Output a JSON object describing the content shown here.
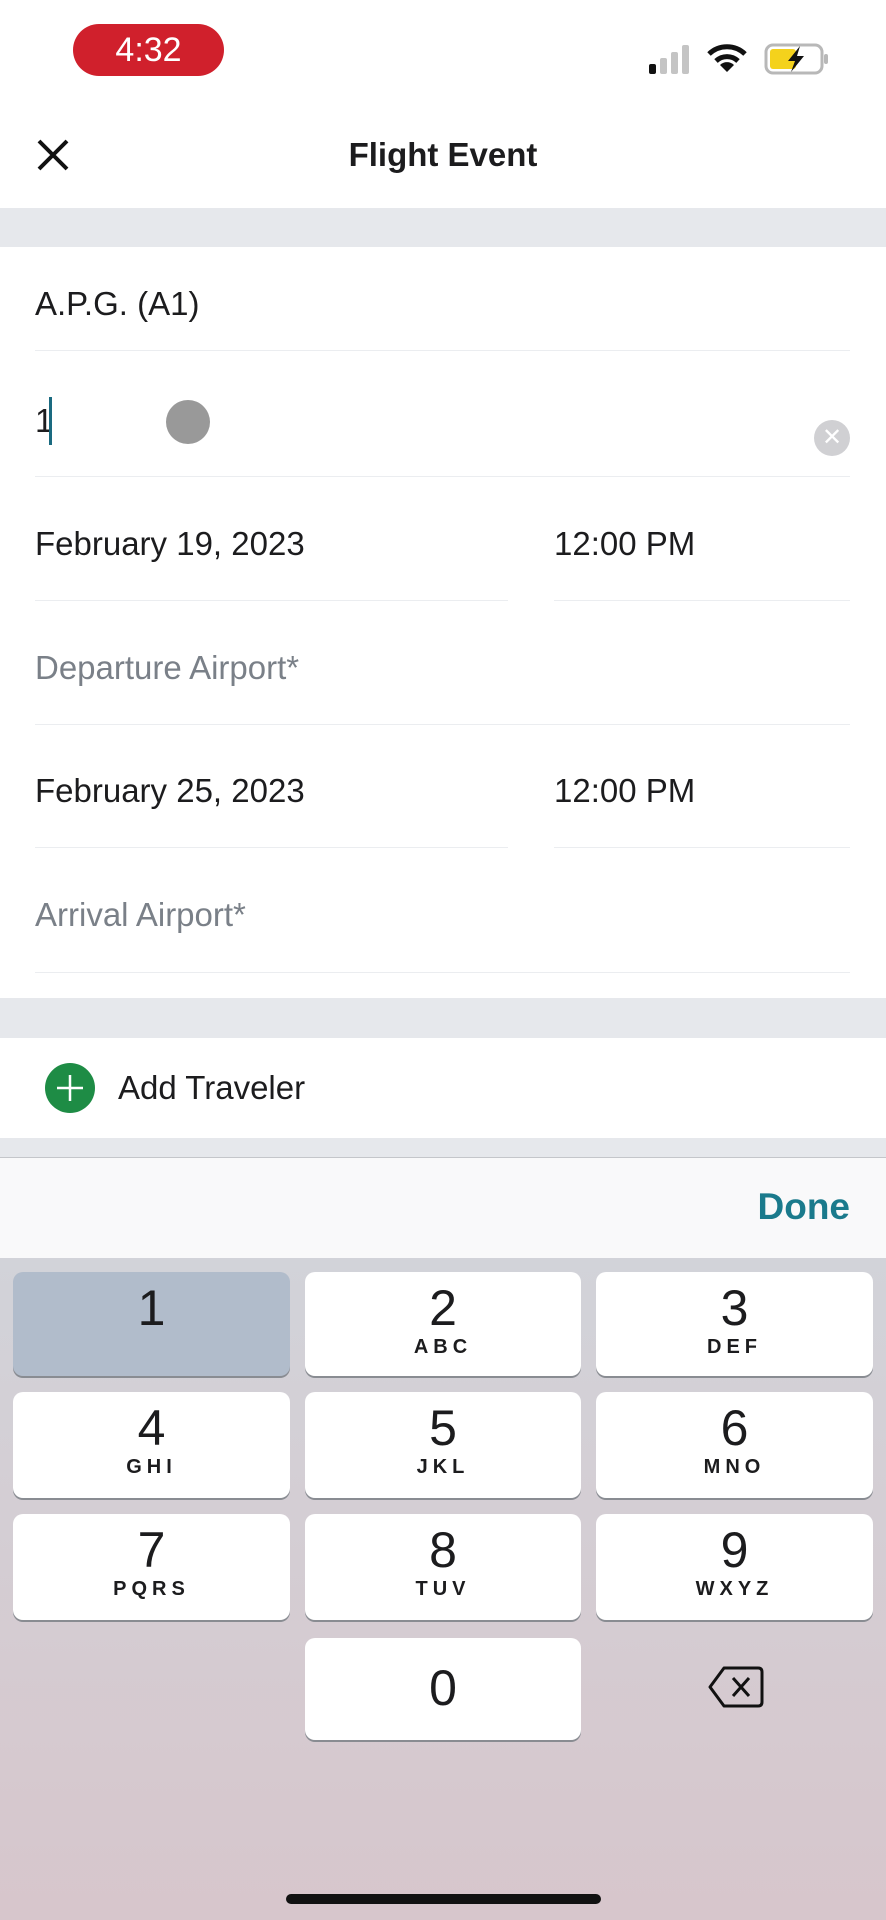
{
  "status_bar": {
    "time": "4:32",
    "signal": "signal-icon",
    "wifi": "wifi-icon",
    "battery": "battery-charging-icon"
  },
  "header": {
    "title": "Flight Event",
    "close_icon": "close-icon"
  },
  "form": {
    "airline": "A.P.G. (A1)",
    "flight_number": "1",
    "departure_date": "February 19, 2023",
    "departure_time": "12:00 PM",
    "departure_airport_placeholder": "Departure Airport*",
    "arrival_date": "February 25, 2023",
    "arrival_time": "12:00 PM",
    "arrival_airport_placeholder": "Arrival Airport*"
  },
  "add_traveler": {
    "label": "Add Traveler",
    "color": "#1e8c45"
  },
  "keyboard": {
    "done_label": "Done",
    "accent": "#1a7a8c",
    "keys": [
      {
        "digit": "1",
        "letters": ""
      },
      {
        "digit": "2",
        "letters": "ABC"
      },
      {
        "digit": "3",
        "letters": "DEF"
      },
      {
        "digit": "4",
        "letters": "GHI"
      },
      {
        "digit": "5",
        "letters": "JKL"
      },
      {
        "digit": "6",
        "letters": "MNO"
      },
      {
        "digit": "7",
        "letters": "PQRS"
      },
      {
        "digit": "8",
        "letters": "TUV"
      },
      {
        "digit": "9",
        "letters": "WXYZ"
      },
      {
        "digit": "0",
        "letters": ""
      }
    ]
  }
}
